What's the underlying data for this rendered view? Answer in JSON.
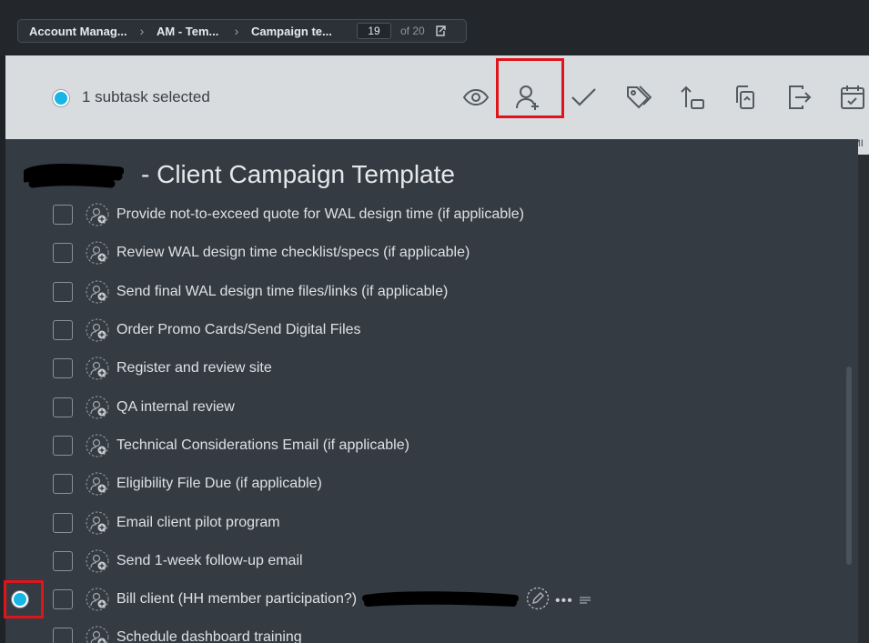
{
  "breadcrumbs": {
    "items": [
      "Account Manag...",
      "AM - Tem...",
      "Campaign te..."
    ],
    "page_current": "19",
    "page_total": "of 20"
  },
  "selection_bar": {
    "text": "1 subtask selected",
    "tools": [
      "eye-icon",
      "user-add-icon",
      "check-icon",
      "tag-icon",
      "move-icon",
      "duplicate-icon",
      "export-icon",
      "calendar-icon"
    ],
    "highlight_color": "#e0141b"
  },
  "dismiss": {
    "label": "DISMI"
  },
  "task": {
    "title_suffix": "- Client Campaign Template"
  },
  "subtasks": [
    {
      "label": "Provide not-to-exceed quote for WAL design time (if applicable)"
    },
    {
      "label": "Review WAL design time checklist/specs (if applicable)"
    },
    {
      "label": "Send final WAL design time files/links (if applicable)"
    },
    {
      "label": "Order Promo Cards/Send Digital Files"
    },
    {
      "label": "Register and review site"
    },
    {
      "label": "QA internal review"
    },
    {
      "label": "Technical Considerations Email (if applicable)"
    },
    {
      "label": "Eligibility File Due (if applicable)"
    },
    {
      "label": "Email client pilot program"
    },
    {
      "label": "Send 1-week follow-up email"
    },
    {
      "label": "Bill client (HH member participation?)"
    },
    {
      "label": "Schedule dashboard training"
    }
  ],
  "colors": {
    "accent": "#18b6e6",
    "panel": "#353b42",
    "selection_bar": "#d9dcdf"
  }
}
